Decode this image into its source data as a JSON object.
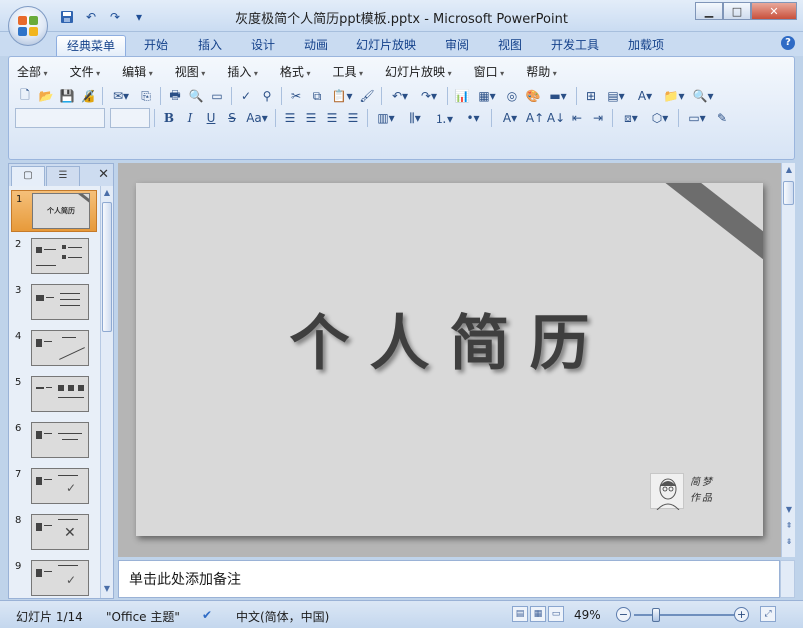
{
  "window": {
    "title": "灰度极简个人简历ppt模板.pptx - Microsoft PowerPoint"
  },
  "qat": {
    "save": "save-icon",
    "undo": "↶",
    "redo": "↷",
    "customize": "▾"
  },
  "ribbon_tabs": [
    {
      "label": "经典菜单",
      "active": true
    },
    {
      "label": "开始"
    },
    {
      "label": "插入"
    },
    {
      "label": "设计"
    },
    {
      "label": "动画"
    },
    {
      "label": "幻灯片放映"
    },
    {
      "label": "审阅"
    },
    {
      "label": "视图"
    },
    {
      "label": "开发工具"
    },
    {
      "label": "加载项"
    }
  ],
  "classic_menu": [
    "全部",
    "文件",
    "编辑",
    "视图",
    "插入",
    "格式",
    "工具",
    "幻灯片放映",
    "窗口",
    "帮助"
  ],
  "slides_panel": {
    "count_label": "幻灯片 1/14",
    "thumbnails": [
      {
        "num": "1",
        "title": "个人简历"
      },
      {
        "num": "2"
      },
      {
        "num": "3"
      },
      {
        "num": "4"
      },
      {
        "num": "5"
      },
      {
        "num": "6"
      },
      {
        "num": "7"
      },
      {
        "num": "8"
      },
      {
        "num": "9"
      }
    ]
  },
  "slide": {
    "title": "个人简历",
    "signature_line1": "简梦",
    "signature_line2": "作品"
  },
  "notes": {
    "placeholder": "单击此处添加备注"
  },
  "status": {
    "slide_info": "幻灯片 1/14",
    "theme": "\"Office 主题\"",
    "language": "中文(简体，中国)",
    "zoom": "49%"
  },
  "colors": {
    "ribbon_blue": "#15428b",
    "selected_thumb": "#e79a3a",
    "slide_bg": "#d9d9d9",
    "title_gray": "#3f3f3f"
  }
}
